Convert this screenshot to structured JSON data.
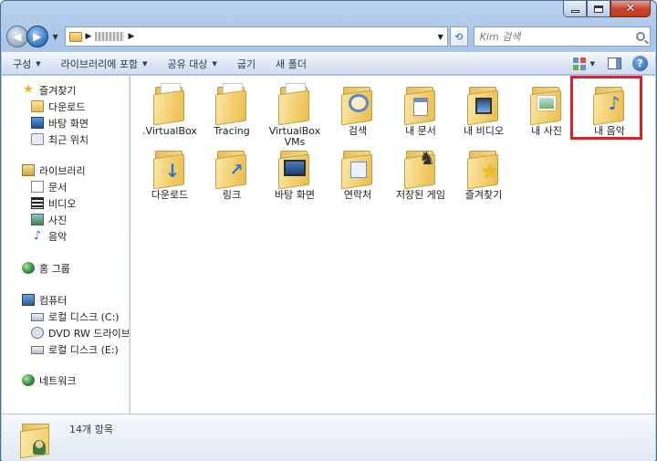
{
  "window": {
    "close_glyph": "✕"
  },
  "address": {
    "search_placeholder": "Kim 검색"
  },
  "toolbar": {
    "items": [
      "구성",
      "라이브러리에 포함",
      "공유 대상",
      "굽기",
      "새 폴더"
    ],
    "dropdown_flags": [
      true,
      true,
      true,
      false,
      false
    ],
    "help_label": "?"
  },
  "nav": {
    "favorites": {
      "header": "즐겨찾기",
      "items": [
        "다운로드",
        "바탕 화면",
        "최근 위치"
      ]
    },
    "libraries": {
      "header": "라이브러리",
      "items": [
        "문서",
        "비디오",
        "사진",
        "음악"
      ]
    },
    "homegroup": "홈 그룹",
    "computer": {
      "header": "컴퓨터",
      "items": [
        "로컬 디스크 (C:)",
        "DVD RW 드라이브 (",
        "로컬 디스크 (E:)"
      ]
    },
    "network": "네트워크"
  },
  "folders": [
    {
      "name": ".VirtualBox",
      "badge": "paper"
    },
    {
      "name": "Tracing",
      "badge": "paper"
    },
    {
      "name": "VirtualBox VMs",
      "badge": "paper"
    },
    {
      "name": "검색",
      "badge": "search"
    },
    {
      "name": "내 문서",
      "badge": "doc"
    },
    {
      "name": "내 비디오",
      "badge": "video"
    },
    {
      "name": "내 사진",
      "badge": "photo"
    },
    {
      "name": "내 음악",
      "badge": "music"
    },
    {
      "name": "다운로드",
      "badge": "download"
    },
    {
      "name": "링크",
      "badge": "link"
    },
    {
      "name": "바탕 화면",
      "badge": "desktop"
    },
    {
      "name": "연락처",
      "badge": "contact"
    },
    {
      "name": "저장된 게임",
      "badge": "game"
    },
    {
      "name": "즐겨찾기",
      "badge": "star"
    }
  ],
  "highlight_color": "#e01f26",
  "details": {
    "item_count": "14개 항목"
  }
}
